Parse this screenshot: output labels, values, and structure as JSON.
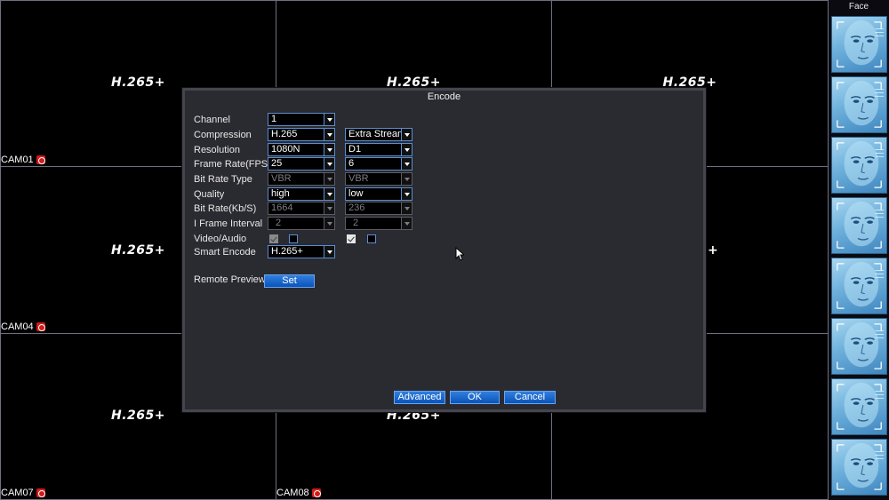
{
  "grid": {
    "cells": [
      {
        "codec": "H.265+",
        "cam": "CAM01"
      },
      {
        "codec": "H.265+",
        "cam": ""
      },
      {
        "codec": "H.265+",
        "cam": ""
      },
      {
        "codec": "H.265+",
        "cam": "CAM04"
      },
      {
        "codec": "",
        "cam": ""
      },
      {
        "codec": "+",
        "cam": ""
      },
      {
        "codec": "H.265+",
        "cam": "CAM07"
      },
      {
        "codec": "H.265+",
        "cam": "CAM08"
      },
      {
        "codec": "",
        "cam": ""
      }
    ]
  },
  "face_panel": {
    "title": "Face",
    "thumb_count": 8
  },
  "dialog": {
    "title": "Encode",
    "labels": {
      "channel": "Channel",
      "compression": "Compression",
      "resolution": "Resolution",
      "frame_rate": "Frame Rate(FPS)",
      "bit_rate_type": "Bit Rate Type",
      "quality": "Quality",
      "bit_rate": "Bit Rate(Kb/S)",
      "i_frame_interval": "I Frame Interval",
      "video_audio": "Video/Audio",
      "smart_encode": "Smart Encode",
      "remote_preview": "Remote Preview"
    },
    "main_stream": {
      "channel": "1",
      "compression": "H.265",
      "resolution": "1080N",
      "frame_rate": "25",
      "bit_rate_type": "VBR",
      "quality": "high",
      "bit_rate": "1664",
      "i_frame_interval": "2",
      "video": true,
      "audio": false,
      "smart_encode": "H.265+"
    },
    "extra_stream": {
      "stream": "Extra Stream",
      "resolution": "D1",
      "frame_rate": "6",
      "bit_rate_type": "VBR",
      "quality": "low",
      "bit_rate": "236",
      "i_frame_interval": "2",
      "video": true,
      "audio": false
    },
    "buttons": {
      "set": "Set",
      "advanced": "Advanced",
      "ok": "OK",
      "cancel": "Cancel"
    }
  },
  "colors": {
    "accent": "#0b53b8",
    "border": "#5a8fd0",
    "dialog_bg": "#2a2a31",
    "rec": "#d11a1a"
  }
}
